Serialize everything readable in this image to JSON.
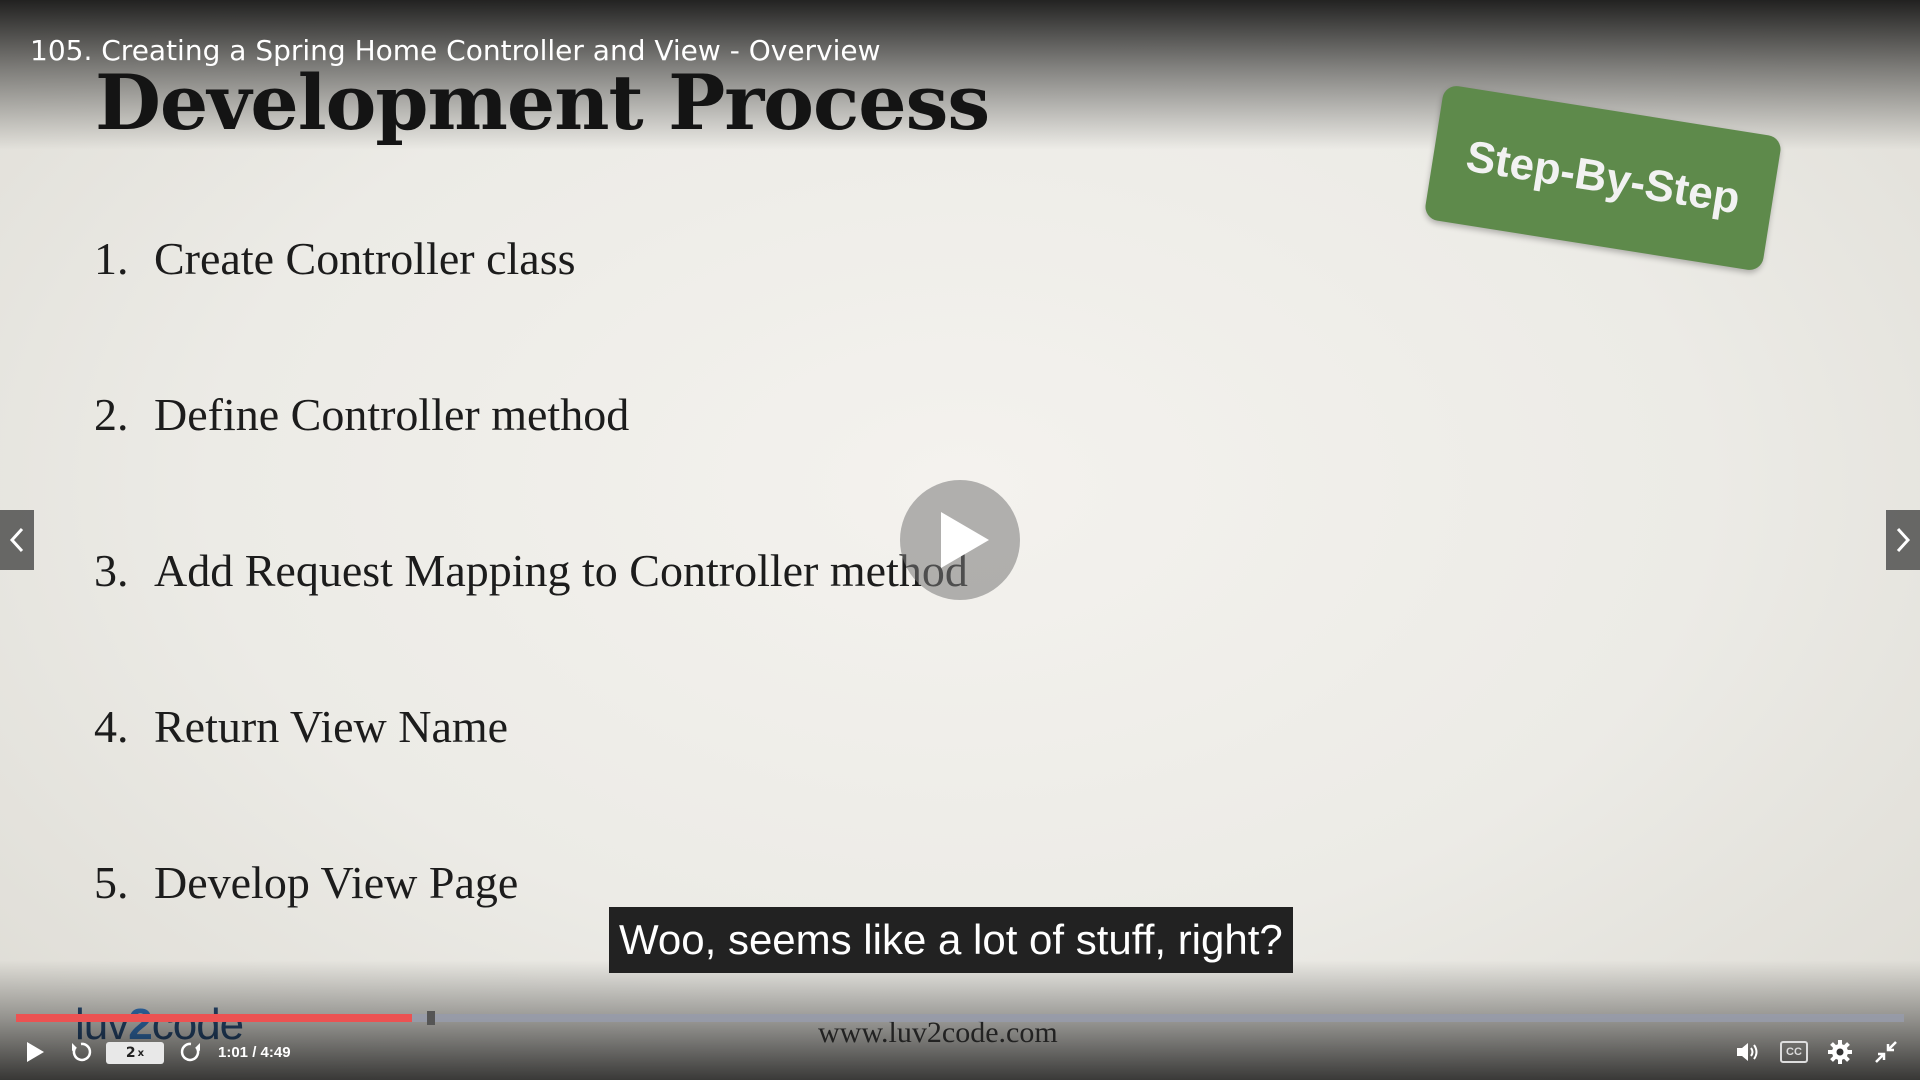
{
  "video": {
    "title": "105. Creating a Spring Home Controller and View - Overview"
  },
  "slide": {
    "heading": "Development Process",
    "stamp_label": "Step-By-Step",
    "steps": [
      {
        "num": "1.",
        "text": "Create Controller class"
      },
      {
        "num": "2.",
        "text": "Define Controller method"
      },
      {
        "num": "3.",
        "text": "Add Request Mapping to Controller method"
      },
      {
        "num": "4.",
        "text": "Return View Name"
      },
      {
        "num": "5.",
        "text": "Develop View Page"
      }
    ],
    "logo": {
      "part1": "luv",
      "part2": "2",
      "part3": "code"
    },
    "website": "www.luv2code.com"
  },
  "caption": "Woo, seems like a lot of stuff, right?",
  "player": {
    "speed_label": "2",
    "speed_suffix": "x",
    "time_display": "1:01 / 4:49",
    "progress_fraction": 0.21,
    "buffered_marker_fraction": 0.22,
    "colors": {
      "progress_played": "#ec5252",
      "progress_track": "#9699aa",
      "stamp_green": "#5e8a4b"
    },
    "icons": [
      "play-icon",
      "rewind-icon",
      "forward-icon",
      "volume-icon",
      "cc-icon",
      "settings-icon",
      "exit-fullscreen-icon",
      "chevron-left-icon",
      "chevron-right-icon"
    ]
  }
}
